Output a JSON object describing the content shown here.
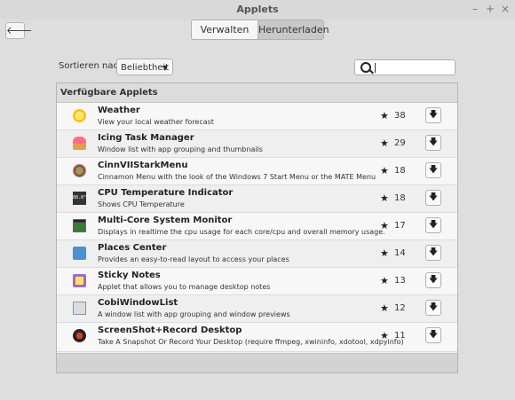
{
  "window": {
    "title": "Applets",
    "controls": {
      "minimize": "–",
      "maximize": "+",
      "close": "×"
    }
  },
  "header": {
    "back_glyph": "🡐",
    "tabs": [
      {
        "label": "Verwalten",
        "active": false
      },
      {
        "label": "Herunterladen",
        "active": true
      }
    ]
  },
  "toolbar": {
    "sort_label": "Sortieren nach",
    "sort_value": "Beliebtheit",
    "search_value": ""
  },
  "list": {
    "header": "Verfügbare Applets",
    "star_glyph": "★",
    "download_glyph": "🡇",
    "items": [
      {
        "name": "Weather",
        "description": "View your local weather forecast",
        "score": "38",
        "icon": "weather-icon"
      },
      {
        "name": "Icing Task Manager",
        "description": "Window list with app grouping and thumbnails",
        "score": "29",
        "icon": "cupcake-icon"
      },
      {
        "name": "CinnVIIStarkMenu",
        "description": "Cinnamon Menu with the look of the Windows 7 Start Menu or the MATE Menu",
        "score": "18",
        "icon": "menu-icon"
      },
      {
        "name": "CPU Temperature Indicator",
        "description": "Shows CPU Temperature",
        "score": "18",
        "icon": "cpu-temperature-icon"
      },
      {
        "name": "Multi-Core System Monitor",
        "description": "Displays in realtime the cpu usage for each core/cpu and overall memory usage.",
        "score": "17",
        "icon": "system-monitor-icon"
      },
      {
        "name": "Places Center",
        "description": "Provides an easy-to-read layout to access your places",
        "score": "14",
        "icon": "places-icon"
      },
      {
        "name": "Sticky Notes",
        "description": "Applet that allows you to manage desktop notes",
        "score": "13",
        "icon": "sticky-notes-icon"
      },
      {
        "name": "CobiWindowList",
        "description": "A window list with app grouping and window previews",
        "score": "12",
        "icon": "window-list-icon"
      },
      {
        "name": "ScreenShot+Record Desktop",
        "description": "Take A Snapshot Or Record Your Desktop (require ffmpeg, xwininfo, xdotool, xdpyinfo)",
        "score": "11",
        "icon": "screenshot-icon"
      }
    ],
    "cpu_icon_text": "88.8°C"
  }
}
